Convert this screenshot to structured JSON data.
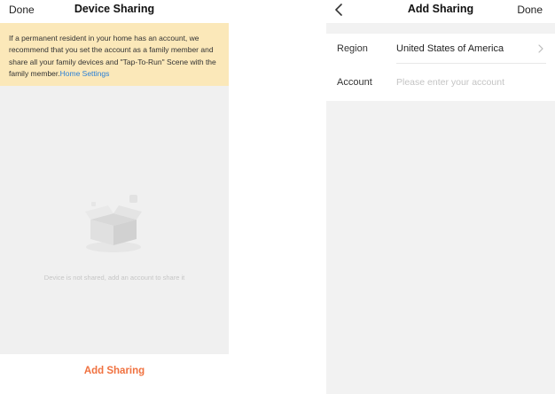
{
  "left_screen": {
    "nav": {
      "done_label": "Done",
      "title": "Device Sharing"
    },
    "notice": {
      "text": "If a permanent resident in your home has an account, we recommend that you set the account as a family member and share all your family devices and \"Tap-To-Run\" Scene with the family member.",
      "link_label": "Home Settings"
    },
    "empty_state": {
      "message": "Device is not shared, add an account to share it",
      "icon": "empty-box-icon"
    },
    "add_sharing_label": "Add Sharing"
  },
  "right_screen": {
    "nav": {
      "back_icon": "chevron-left-icon",
      "title": "Add Sharing",
      "done_label": "Done"
    },
    "region": {
      "label": "Region",
      "value": "United States of America",
      "icon": "chevron-right-icon"
    },
    "account": {
      "label": "Account",
      "value": "",
      "placeholder": "Please enter your account"
    }
  },
  "colors": {
    "notice_bg": "#fbe8b9",
    "link": "#2a7fd6",
    "accent": "#f0713f",
    "empty_bg": "#f0f0f0"
  }
}
